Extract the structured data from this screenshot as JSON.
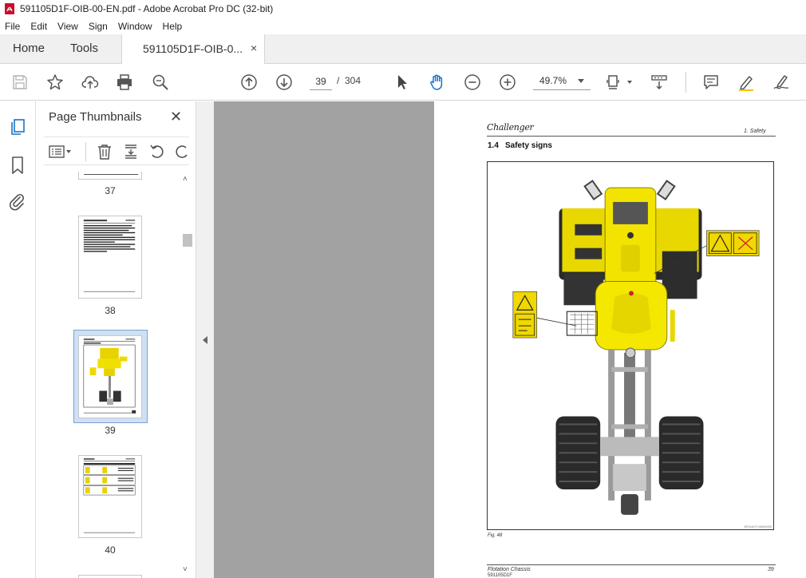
{
  "window": {
    "title": "591105D1F-OIB-00-EN.pdf - Adobe Acrobat Pro DC (32-bit)"
  },
  "menu": {
    "items": [
      "File",
      "Edit",
      "View",
      "Sign",
      "Window",
      "Help"
    ]
  },
  "tabs": {
    "home": "Home",
    "tools": "Tools",
    "document": "591105D1F-OIB-0...",
    "close": "×"
  },
  "toolbar": {
    "icons": [
      "save-icon",
      "bookmark-star-icon",
      "upload-cloud-icon",
      "print-icon",
      "find-zoom-icon",
      "page-up-icon",
      "page-down-icon",
      "select-arrow-icon",
      "hand-pan-icon",
      "zoom-out-icon",
      "zoom-in-icon",
      "page-fit-icon",
      "scroll-mode-icon",
      "comment-icon",
      "highlight-pen-icon",
      "sign-pen-icon"
    ],
    "current_page": "39",
    "page_separator": "/",
    "total_pages": "304",
    "zoom": "49.7%",
    "accent_color": "#1a73c8"
  },
  "panel": {
    "title": "Page Thumbnails",
    "close": "✕",
    "thumbnails": [
      {
        "label": "37"
      },
      {
        "label": "38"
      },
      {
        "label": "39",
        "selected": true
      },
      {
        "label": "40"
      }
    ]
  },
  "page": {
    "brand": "Challenger",
    "section": "1. Safety",
    "heading_num": "1.4",
    "heading": "Safety signs",
    "figure_code": "6F0JAGY16W0009",
    "caption": "Fig. 48",
    "footer_left": "Flotation Chassis",
    "footer_code": "591105D1F",
    "footer_page": "39"
  }
}
